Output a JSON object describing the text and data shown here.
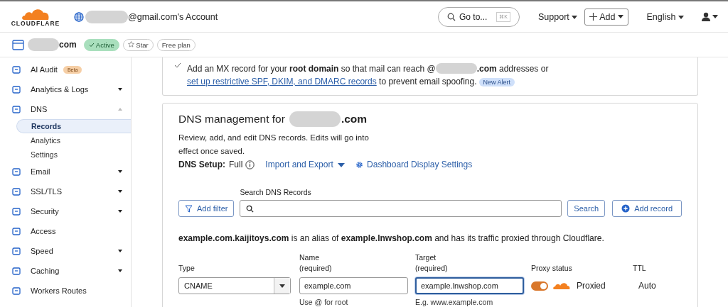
{
  "header": {
    "logo_text": "CLOUDFLARE",
    "account": "@gmail.com's Account",
    "goto": "Go to...",
    "shortcut": "⌘K",
    "support": "Support",
    "add": "Add",
    "language": "English"
  },
  "zone": {
    "domain": "com",
    "status": "Active",
    "star": "Star",
    "plan": "Free plan"
  },
  "sidebar": {
    "items": [
      {
        "label": "AI Audit",
        "kind": "link",
        "badge": "Beta"
      },
      {
        "label": "Analytics & Logs",
        "kind": "group",
        "expanded": false
      },
      {
        "label": "DNS",
        "kind": "group",
        "expanded": true,
        "children": [
          {
            "label": "Records",
            "selected": true
          },
          {
            "label": "Analytics",
            "selected": false
          },
          {
            "label": "Settings",
            "selected": false
          }
        ]
      },
      {
        "label": "Email",
        "kind": "group",
        "expanded": false
      },
      {
        "label": "SSL/TLS",
        "kind": "group",
        "expanded": false
      },
      {
        "label": "Security",
        "kind": "group",
        "expanded": false
      },
      {
        "label": "Access",
        "kind": "link"
      },
      {
        "label": "Speed",
        "kind": "group",
        "expanded": false
      },
      {
        "label": "Caching",
        "kind": "group",
        "expanded": false
      },
      {
        "label": "Workers Routes",
        "kind": "link"
      }
    ]
  },
  "alert": {
    "before": "Add an MX record for your **root domain** so that mail can reach @",
    "after": "**.com** addresses or",
    "link": "set up restrictive SPF, DKIM, and DMARC records",
    "tail": "to prevent email spoofing.",
    "badge": "New Alert"
  },
  "dns": {
    "title": "DNS management for",
    "title_suffix": ".com",
    "description": "Review, add, and edit DNS records. Edits will go into effect once saved.",
    "setup_label": "DNS Setup:",
    "setup_value": "Full",
    "import_export": "Import and Export",
    "display_settings": "Dashboard Display Settings",
    "search_label": "Search DNS Records",
    "add_filter": "Add filter",
    "search_button": "Search",
    "add_record": "Add record",
    "alias_note": "**example.com.kaijitoys.com** is an alias of **example.lnwshop.com** and has its traffic proxied through Cloudflare.",
    "form": {
      "type_label": "Type",
      "type_value": "CNAME",
      "name_label": "Name",
      "name_required": "(required)",
      "name_value": "example.com",
      "name_hint": "Use @ for root",
      "target_label": "Target",
      "target_required": "(required)",
      "target_value": "example.lnwshop.com",
      "target_hint": "E.g. www.example.com",
      "proxy_label": "Proxy status",
      "proxied": true,
      "proxy_text": "Proxied",
      "ttl_label": "TTL",
      "ttl_value": "Auto"
    }
  }
}
